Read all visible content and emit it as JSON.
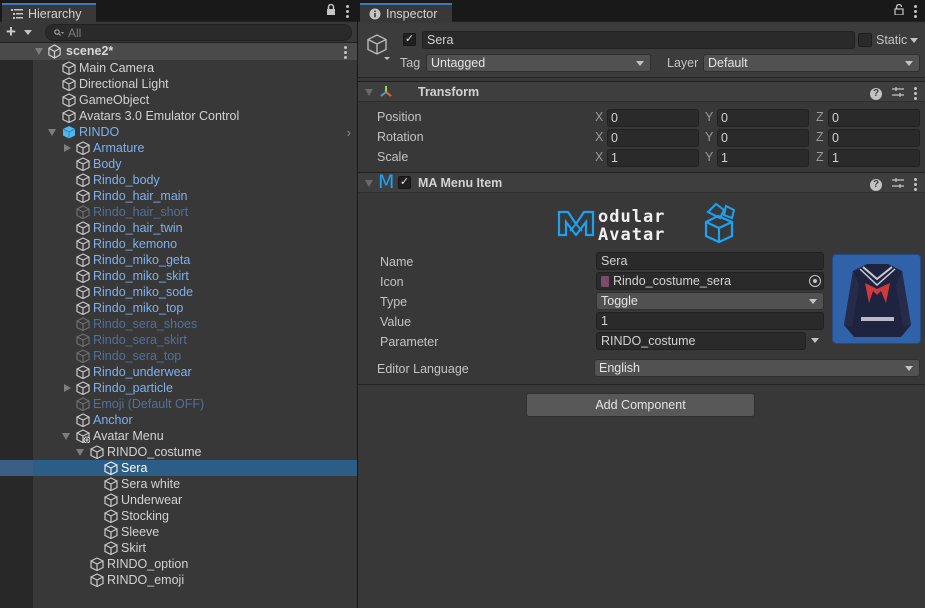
{
  "hierarchy": {
    "tab_label": "Hierarchy",
    "search_placeholder": "All",
    "scene": "scene2*",
    "rows": [
      {
        "label": "Main Camera",
        "depth": 0,
        "arrow": "none",
        "style": "normal",
        "icon": "cube"
      },
      {
        "label": "Directional Light",
        "depth": 0,
        "arrow": "none",
        "style": "normal",
        "icon": "cube"
      },
      {
        "label": "GameObject",
        "depth": 0,
        "arrow": "none",
        "style": "normal",
        "icon": "cube"
      },
      {
        "label": "Avatars 3.0 Emulator Control",
        "depth": 0,
        "arrow": "none",
        "style": "normal",
        "icon": "cube"
      },
      {
        "label": "RINDO",
        "depth": 0,
        "arrow": "down",
        "style": "prefab",
        "icon": "prefab-cube",
        "chevron": true
      },
      {
        "label": "Armature",
        "depth": 1,
        "arrow": "right",
        "style": "prefab",
        "icon": "cube"
      },
      {
        "label": "Body",
        "depth": 1,
        "arrow": "none",
        "style": "prefab",
        "icon": "cube"
      },
      {
        "label": "Rindo_body",
        "depth": 1,
        "arrow": "none",
        "style": "prefab",
        "icon": "cube"
      },
      {
        "label": "Rindo_hair_main",
        "depth": 1,
        "arrow": "none",
        "style": "prefab",
        "icon": "cube"
      },
      {
        "label": "Rindo_hair_short",
        "depth": 1,
        "arrow": "none",
        "style": "prefab-dim",
        "icon": "cube"
      },
      {
        "label": "Rindo_hair_twin",
        "depth": 1,
        "arrow": "none",
        "style": "prefab",
        "icon": "cube"
      },
      {
        "label": "Rindo_kemono",
        "depth": 1,
        "arrow": "none",
        "style": "prefab",
        "icon": "cube"
      },
      {
        "label": "Rindo_miko_geta",
        "depth": 1,
        "arrow": "none",
        "style": "prefab",
        "icon": "cube"
      },
      {
        "label": "Rindo_miko_skirt",
        "depth": 1,
        "arrow": "none",
        "style": "prefab",
        "icon": "cube"
      },
      {
        "label": "Rindo_miko_sode",
        "depth": 1,
        "arrow": "none",
        "style": "prefab",
        "icon": "cube"
      },
      {
        "label": "Rindo_miko_top",
        "depth": 1,
        "arrow": "none",
        "style": "prefab",
        "icon": "cube"
      },
      {
        "label": "Rindo_sera_shoes",
        "depth": 1,
        "arrow": "none",
        "style": "prefab-dim",
        "icon": "cube"
      },
      {
        "label": "Rindo_sera_skirt",
        "depth": 1,
        "arrow": "none",
        "style": "prefab-dim",
        "icon": "cube"
      },
      {
        "label": "Rindo_sera_top",
        "depth": 1,
        "arrow": "none",
        "style": "prefab-dim",
        "icon": "cube"
      },
      {
        "label": "Rindo_underwear",
        "depth": 1,
        "arrow": "none",
        "style": "prefab",
        "icon": "cube"
      },
      {
        "label": "Rindo_particle",
        "depth": 1,
        "arrow": "right",
        "style": "prefab",
        "icon": "cube"
      },
      {
        "label": "Emoji (Default OFF)",
        "depth": 1,
        "arrow": "none",
        "style": "prefab-dim",
        "icon": "cube"
      },
      {
        "label": "Anchor",
        "depth": 1,
        "arrow": "none",
        "style": "prefab",
        "icon": "cube"
      },
      {
        "label": "Avatar Menu",
        "depth": 1,
        "arrow": "down",
        "style": "normal",
        "icon": "cube-added"
      },
      {
        "label": "RINDO_costume",
        "depth": 2,
        "arrow": "down",
        "style": "normal",
        "icon": "cube"
      },
      {
        "label": "Sera",
        "depth": 3,
        "arrow": "none",
        "style": "normal",
        "icon": "cube",
        "selected": true
      },
      {
        "label": "Sera white",
        "depth": 3,
        "arrow": "none",
        "style": "normal",
        "icon": "cube"
      },
      {
        "label": "Underwear",
        "depth": 3,
        "arrow": "none",
        "style": "normal",
        "icon": "cube"
      },
      {
        "label": "Stocking",
        "depth": 3,
        "arrow": "none",
        "style": "normal",
        "icon": "cube"
      },
      {
        "label": "Sleeve",
        "depth": 3,
        "arrow": "none",
        "style": "normal",
        "icon": "cube"
      },
      {
        "label": "Skirt",
        "depth": 3,
        "arrow": "none",
        "style": "normal",
        "icon": "cube"
      },
      {
        "label": "RINDO_option",
        "depth": 2,
        "arrow": "none",
        "style": "normal",
        "icon": "cube"
      },
      {
        "label": "RINDO_emoji",
        "depth": 2,
        "arrow": "none",
        "style": "normal",
        "icon": "cube"
      }
    ]
  },
  "inspector": {
    "tab_label": "Inspector",
    "gameobject": {
      "active": true,
      "name": "Sera",
      "static_label": "Static",
      "static": false,
      "tag_label": "Tag",
      "tag": "Untagged",
      "layer_label": "Layer",
      "layer": "Default"
    },
    "transform": {
      "title": "Transform",
      "rows": [
        {
          "label": "Position",
          "x": "0",
          "y": "0",
          "z": "0"
        },
        {
          "label": "Rotation",
          "x": "0",
          "y": "0",
          "z": "0"
        },
        {
          "label": "Scale",
          "x": "1",
          "y": "1",
          "z": "1"
        }
      ],
      "axis_labels": {
        "x": "X",
        "y": "Y",
        "z": "Z"
      }
    },
    "menu_item": {
      "title": "MA Menu Item",
      "enabled": true,
      "logo_icon": "M",
      "logo_text_line1": "odular",
      "logo_text_line2": "Avatar",
      "fields": {
        "name_label": "Name",
        "name": "Sera",
        "icon_label": "Icon",
        "icon": "Rindo_costume_sera",
        "type_label": "Type",
        "type": "Toggle",
        "value_label": "Value",
        "value": "1",
        "parameter_label": "Parameter",
        "parameter": "RINDO_costume"
      },
      "editor_language_label": "Editor Language",
      "editor_language": "English"
    },
    "add_component_label": "Add Component"
  },
  "colors": {
    "accent": "#3a79bb",
    "selection": "#2c5d87",
    "prefab_text": "#7fb0f0",
    "modular_avatar_blue": "#1da1f2"
  }
}
